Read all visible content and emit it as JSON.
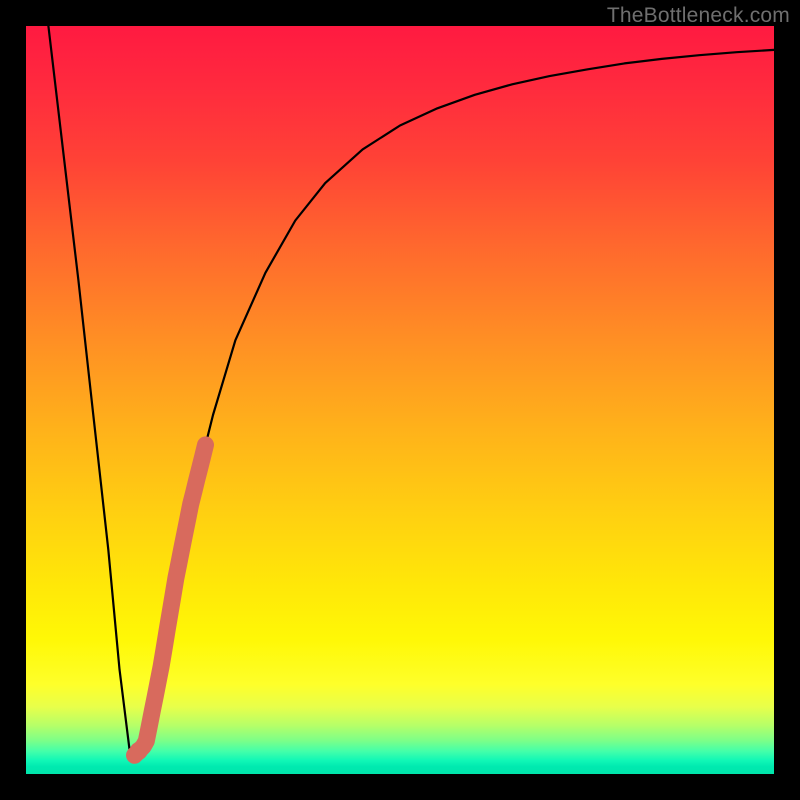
{
  "watermark": {
    "text": "TheBottleneck.com"
  },
  "colors": {
    "frame": "#000000",
    "curve": "#000000",
    "highlight": "#d86a5d"
  },
  "chart_data": {
    "type": "line",
    "title": "",
    "xlabel": "",
    "ylabel": "",
    "xlim": [
      0,
      100
    ],
    "ylim": [
      0,
      100
    ],
    "series": [
      {
        "name": "bottleneck-curve",
        "x": [
          3,
          5,
          7,
          9,
          11,
          12.5,
          14,
          16,
          18,
          20,
          22,
          25,
          28,
          32,
          36,
          40,
          45,
          50,
          55,
          60,
          65,
          70,
          75,
          80,
          85,
          90,
          95,
          100
        ],
        "values": [
          100,
          83,
          66,
          48,
          30,
          14,
          2,
          4,
          14,
          26,
          36,
          48,
          58,
          67,
          74,
          79,
          83.5,
          86.7,
          89,
          90.8,
          92.2,
          93.3,
          94.2,
          95,
          95.6,
          96.1,
          96.5,
          96.8
        ]
      }
    ],
    "annotations": [
      {
        "name": "highlight-segment",
        "x_range": [
          14.5,
          24
        ],
        "note": "thick salmon overlay on rising branch"
      }
    ]
  }
}
